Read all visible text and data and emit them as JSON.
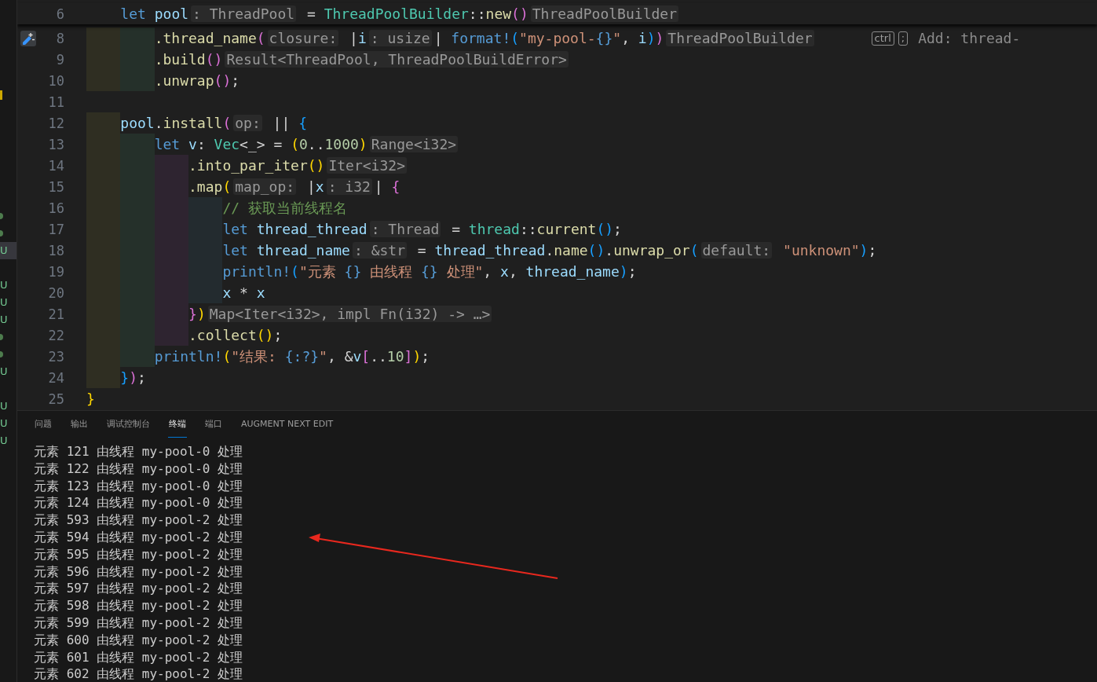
{
  "explorer_strip": {
    "rows": [
      {
        "kind": "blank",
        "selected": false
      },
      {
        "kind": "blank",
        "selected": false
      },
      {
        "kind": "blank",
        "selected": false
      },
      {
        "kind": "blank",
        "selected": false
      },
      {
        "kind": "blank",
        "selected": false
      },
      {
        "kind": "mark",
        "selected": false
      },
      {
        "kind": "blank",
        "selected": false
      },
      {
        "kind": "blank",
        "selected": false
      },
      {
        "kind": "blank",
        "selected": false
      },
      {
        "kind": "blank",
        "selected": false
      },
      {
        "kind": "blank",
        "selected": false
      },
      {
        "kind": "blank",
        "selected": false
      },
      {
        "kind": "dot",
        "selected": false
      },
      {
        "kind": "dot",
        "selected": false
      },
      {
        "kind": "letter",
        "text": "U",
        "selected": true
      },
      {
        "kind": "blank",
        "selected": false
      },
      {
        "kind": "letter",
        "text": "U",
        "selected": false
      },
      {
        "kind": "letter",
        "text": "U",
        "selected": false
      },
      {
        "kind": "letter",
        "text": "U",
        "selected": false
      },
      {
        "kind": "dot",
        "selected": false
      },
      {
        "kind": "dot",
        "selected": false
      },
      {
        "kind": "letter",
        "text": "U",
        "selected": false
      },
      {
        "kind": "blank",
        "selected": false
      },
      {
        "kind": "letter",
        "text": "U",
        "selected": false
      },
      {
        "kind": "letter",
        "text": "U",
        "selected": false
      },
      {
        "kind": "letter",
        "text": "U",
        "selected": false
      }
    ]
  },
  "editor": {
    "sticky_line": {
      "number": "6",
      "tokens": [
        {
          "kind": "keyword",
          "text": "    let "
        },
        {
          "kind": "variable",
          "text": "pool"
        },
        {
          "kind": "hint",
          "text": ": ThreadPool"
        },
        {
          "kind": "punct",
          "text": " = "
        },
        {
          "kind": "type",
          "text": "ThreadPoolBuilder"
        },
        {
          "kind": "punct",
          "text": "::"
        },
        {
          "kind": "function",
          "text": "new"
        },
        {
          "kind": "bracket2",
          "text": "()"
        },
        {
          "kind": "hint",
          "text": "ThreadPoolBuilder"
        }
      ]
    },
    "lines": [
      {
        "number": "8",
        "gutter_icon": true,
        "tokens": [
          {
            "kind": "function",
            "text": "        .thread_name"
          },
          {
            "kind": "bracket2",
            "text": "("
          },
          {
            "kind": "hint",
            "text": "closure:"
          },
          {
            "kind": "punct",
            "text": " |"
          },
          {
            "kind": "variable",
            "text": "i"
          },
          {
            "kind": "hint",
            "text": ": usize"
          },
          {
            "kind": "punct",
            "text": "| "
          },
          {
            "kind": "macro",
            "text": "format!"
          },
          {
            "kind": "bracket3",
            "text": "("
          },
          {
            "kind": "string",
            "text": "\"my-pool-"
          },
          {
            "kind": "format",
            "text": "{}"
          },
          {
            "kind": "string",
            "text": "\""
          },
          {
            "kind": "punct",
            "text": ", "
          },
          {
            "kind": "variable",
            "text": "i"
          },
          {
            "kind": "bracket3",
            "text": ")"
          },
          {
            "kind": "bracket2",
            "text": ")"
          },
          {
            "kind": "hint",
            "text": "ThreadPoolBuilder"
          }
        ],
        "suggestion": {
          "keys": [
            "ctrl",
            ";"
          ],
          "text": "Add: thread-"
        }
      },
      {
        "number": "9",
        "gutter_icon": false,
        "tokens": [
          {
            "kind": "function",
            "text": "        .build"
          },
          {
            "kind": "bracket2",
            "text": "()"
          },
          {
            "kind": "hint",
            "text": "Result<ThreadPool, ThreadPoolBuildError>"
          }
        ]
      },
      {
        "number": "10",
        "gutter_icon": false,
        "tokens": [
          {
            "kind": "function",
            "text": "        .unwrap"
          },
          {
            "kind": "bracket2",
            "text": "()"
          },
          {
            "kind": "punct",
            "text": ";"
          }
        ]
      },
      {
        "number": "11",
        "gutter_icon": false
      },
      {
        "number": "12",
        "gutter_icon": false,
        "tokens": [
          {
            "kind": "variable",
            "text": "    pool"
          },
          {
            "kind": "punct",
            "text": "."
          },
          {
            "kind": "function",
            "text": "install"
          },
          {
            "kind": "bracket2",
            "text": "("
          },
          {
            "kind": "hint",
            "text": "op:"
          },
          {
            "kind": "punct",
            "text": " || "
          },
          {
            "kind": "bracket3",
            "text": "{"
          }
        ]
      },
      {
        "number": "13",
        "gutter_icon": false,
        "tokens": [
          {
            "kind": "keyword",
            "text": "        let "
          },
          {
            "kind": "variable",
            "text": "v"
          },
          {
            "kind": "punct",
            "text": ": "
          },
          {
            "kind": "type",
            "text": "Vec"
          },
          {
            "kind": "punct",
            "text": "<_> = "
          },
          {
            "kind": "bracket1",
            "text": "("
          },
          {
            "kind": "number",
            "text": "0"
          },
          {
            "kind": "punct",
            "text": ".."
          },
          {
            "kind": "number",
            "text": "1000"
          },
          {
            "kind": "bracket1",
            "text": ")"
          },
          {
            "kind": "hint",
            "text": "Range<i32>"
          }
        ]
      },
      {
        "number": "14",
        "gutter_icon": false,
        "tokens": [
          {
            "kind": "function",
            "text": "            .into_par_iter"
          },
          {
            "kind": "bracket1",
            "text": "()"
          },
          {
            "kind": "hint",
            "text": "Iter<i32>"
          }
        ]
      },
      {
        "number": "15",
        "gutter_icon": false,
        "tokens": [
          {
            "kind": "function",
            "text": "            .map"
          },
          {
            "kind": "bracket1",
            "text": "("
          },
          {
            "kind": "hint",
            "text": "map_op:"
          },
          {
            "kind": "punct",
            "text": " |"
          },
          {
            "kind": "variable",
            "text": "x"
          },
          {
            "kind": "hint",
            "text": ": i32"
          },
          {
            "kind": "punct",
            "text": "| "
          },
          {
            "kind": "bracket2",
            "text": "{"
          }
        ]
      },
      {
        "number": "16",
        "gutter_icon": false,
        "tokens": [
          {
            "kind": "comment",
            "text": "                // 获取当前线程名"
          }
        ]
      },
      {
        "number": "17",
        "gutter_icon": false,
        "tokens": [
          {
            "kind": "keyword",
            "text": "                let "
          },
          {
            "kind": "variable",
            "text": "thread_thread"
          },
          {
            "kind": "hint",
            "text": ": Thread"
          },
          {
            "kind": "punct",
            "text": " = "
          },
          {
            "kind": "type",
            "text": "thread"
          },
          {
            "kind": "punct",
            "text": "::"
          },
          {
            "kind": "function",
            "text": "current"
          },
          {
            "kind": "bracket3",
            "text": "()"
          },
          {
            "kind": "punct",
            "text": ";"
          }
        ]
      },
      {
        "number": "18",
        "gutter_icon": false,
        "tokens": [
          {
            "kind": "keyword",
            "text": "                let "
          },
          {
            "kind": "variable",
            "text": "thread_name"
          },
          {
            "kind": "hint",
            "text": ": &str"
          },
          {
            "kind": "punct",
            "text": " = "
          },
          {
            "kind": "variable",
            "text": "thread_thread"
          },
          {
            "kind": "punct",
            "text": "."
          },
          {
            "kind": "function",
            "text": "name"
          },
          {
            "kind": "bracket3",
            "text": "()"
          },
          {
            "kind": "punct",
            "text": "."
          },
          {
            "kind": "function",
            "text": "unwrap_or"
          },
          {
            "kind": "bracket3",
            "text": "("
          },
          {
            "kind": "hint",
            "text": "default:"
          },
          {
            "kind": "string",
            "text": " \"unknown\""
          },
          {
            "kind": "bracket3",
            "text": ")"
          },
          {
            "kind": "punct",
            "text": ";"
          }
        ]
      },
      {
        "number": "19",
        "gutter_icon": false,
        "tokens": [
          {
            "kind": "macro",
            "text": "                println!"
          },
          {
            "kind": "bracket3",
            "text": "("
          },
          {
            "kind": "string",
            "text": "\"元素 "
          },
          {
            "kind": "format",
            "text": "{}"
          },
          {
            "kind": "string",
            "text": " 由线程 "
          },
          {
            "kind": "format",
            "text": "{}"
          },
          {
            "kind": "string",
            "text": " 处理\""
          },
          {
            "kind": "punct",
            "text": ", "
          },
          {
            "kind": "variable",
            "text": "x"
          },
          {
            "kind": "punct",
            "text": ", "
          },
          {
            "kind": "variable",
            "text": "thread_name"
          },
          {
            "kind": "bracket3",
            "text": ")"
          },
          {
            "kind": "punct",
            "text": ";"
          }
        ]
      },
      {
        "number": "20",
        "gutter_icon": false,
        "tokens": [
          {
            "kind": "variable",
            "text": "                x"
          },
          {
            "kind": "punct",
            "text": " * "
          },
          {
            "kind": "variable",
            "text": "x"
          }
        ]
      },
      {
        "number": "21",
        "gutter_icon": false,
        "tokens": [
          {
            "kind": "bracket2",
            "text": "            }"
          },
          {
            "kind": "bracket1",
            "text": ")"
          },
          {
            "kind": "hint",
            "text": "Map<Iter<i32>, impl Fn(i32) -> …>"
          }
        ]
      },
      {
        "number": "22",
        "gutter_icon": false,
        "tokens": [
          {
            "kind": "function",
            "text": "            .collect"
          },
          {
            "kind": "bracket1",
            "text": "()"
          },
          {
            "kind": "punct",
            "text": ";"
          }
        ]
      },
      {
        "number": "23",
        "gutter_icon": false,
        "tokens": [
          {
            "kind": "macro",
            "text": "        println!"
          },
          {
            "kind": "bracket1",
            "text": "("
          },
          {
            "kind": "string",
            "text": "\"结果: "
          },
          {
            "kind": "format",
            "text": "{:?}"
          },
          {
            "kind": "string",
            "text": "\""
          },
          {
            "kind": "punct",
            "text": ", &"
          },
          {
            "kind": "variable",
            "text": "v"
          },
          {
            "kind": "bracket2",
            "text": "["
          },
          {
            "kind": "punct",
            "text": ".."
          },
          {
            "kind": "number",
            "text": "10"
          },
          {
            "kind": "bracket2",
            "text": "]"
          },
          {
            "kind": "bracket1",
            "text": ")"
          },
          {
            "kind": "punct",
            "text": ";"
          }
        ]
      },
      {
        "number": "24",
        "gutter_icon": false,
        "tokens": [
          {
            "kind": "bracket3",
            "text": "    }"
          },
          {
            "kind": "bracket2",
            "text": ")"
          },
          {
            "kind": "punct",
            "text": ";"
          }
        ]
      },
      {
        "number": "25",
        "gutter_icon": false,
        "tokens": [
          {
            "kind": "bracket1",
            "text": "}"
          }
        ]
      }
    ]
  },
  "panel": {
    "tabs": [
      {
        "label": "问题",
        "selected": false
      },
      {
        "label": "输出",
        "selected": false
      },
      {
        "label": "调试控制台",
        "selected": false
      },
      {
        "label": "终端",
        "selected": true
      },
      {
        "label": "端口",
        "selected": false
      },
      {
        "label": "AUGMENT NEXT EDIT",
        "selected": false
      }
    ],
    "terminal_lines": [
      "元素 121 由线程 my-pool-0 处理",
      "元素 122 由线程 my-pool-0 处理",
      "元素 123 由线程 my-pool-0 处理",
      "元素 124 由线程 my-pool-0 处理",
      "元素 593 由线程 my-pool-2 处理",
      "元素 594 由线程 my-pool-2 处理",
      "元素 595 由线程 my-pool-2 处理",
      "元素 596 由线程 my-pool-2 处理",
      "元素 597 由线程 my-pool-2 处理",
      "元素 598 由线程 my-pool-2 处理",
      "元素 599 由线程 my-pool-2 处理",
      "元素 600 由线程 my-pool-2 处理",
      "元素 601 由线程 my-pool-2 处理",
      "元素 602 由线程 my-pool-2 处理"
    ]
  }
}
